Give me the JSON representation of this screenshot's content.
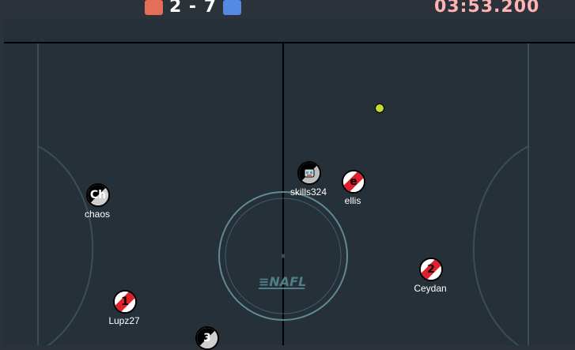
{
  "scoreboard": {
    "score": "2 - 7",
    "timer": "03:53.200",
    "red_team_color": "#e56e56",
    "blue_team_color": "#5688e5",
    "timer_color": "#ffb3b3"
  },
  "field": {
    "logo_text": "≡NAFL"
  },
  "players": [
    {
      "name": "chaos",
      "avatar": "Ch",
      "team": "spectator-style"
    },
    {
      "name": "skills324",
      "avatar": "robot-icon",
      "team": "blue"
    },
    {
      "name": "ellis",
      "avatar": "e",
      "team": "red"
    },
    {
      "name": "Ceydan",
      "avatar": "2",
      "team": "red"
    },
    {
      "name": "Lupz27",
      "avatar": "1",
      "team": "red"
    },
    {
      "name": "",
      "avatar": "3",
      "team": "blue"
    }
  ],
  "ball": {
    "color": "#c7d93a"
  }
}
